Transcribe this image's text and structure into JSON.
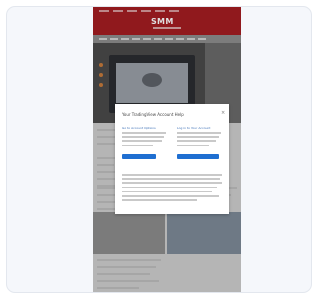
{
  "site": {
    "logo_text": "SMM"
  },
  "consent_dialog": {
    "title": "Your TradingView Account Help",
    "close_glyph": "×",
    "left_column_heading": "Go to Account Options",
    "right_column_heading": "Log in to Your Account"
  }
}
